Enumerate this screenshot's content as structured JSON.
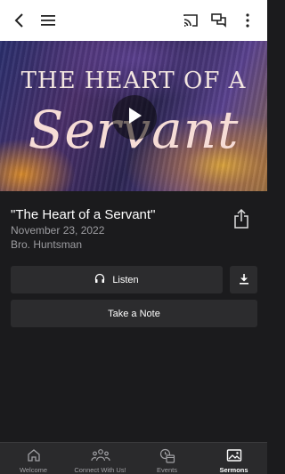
{
  "topbar": {
    "icons": [
      "back-arrow-icon",
      "menu-icon",
      "cast-icon",
      "chat-icon",
      "more-vert-icon"
    ]
  },
  "hero": {
    "title_line": "The Heart of a",
    "script_line": "Servant",
    "play_icon": "play-icon"
  },
  "sermon": {
    "title": "\"The Heart of a Servant\"",
    "date": "November 23, 2022",
    "speaker": "Bro. Huntsman"
  },
  "actions": {
    "listen_label": "Listen",
    "note_label": "Take a Note"
  },
  "nav": {
    "items": [
      {
        "label": "Welcome",
        "icon": "home-icon"
      },
      {
        "label": "Connect With Us!",
        "icon": "people-icon"
      },
      {
        "label": "Events",
        "icon": "events-icon"
      },
      {
        "label": "Sermons",
        "icon": "image-icon",
        "active": true
      }
    ]
  },
  "colors": {
    "background": "#1b1b1d",
    "topbar": "#ffffff",
    "button": "#2c2c2e",
    "nav": "#2a2a2c",
    "muted_text": "#9c9ca0"
  }
}
